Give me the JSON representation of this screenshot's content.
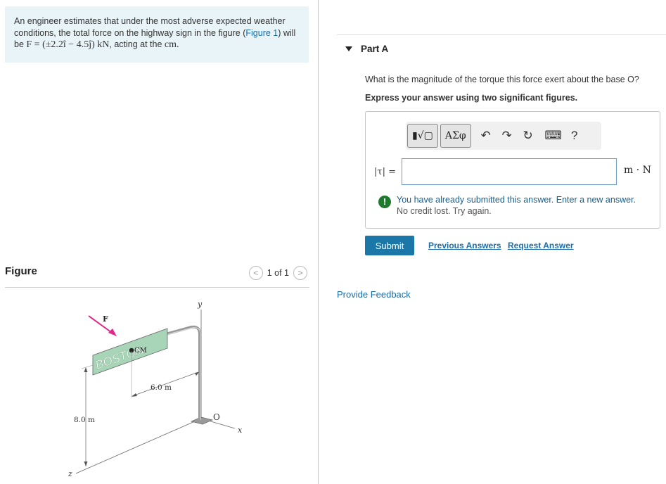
{
  "problem": {
    "text_before_link": "An engineer estimates that under the most adverse expected weather conditions, the total force on the highway sign in the figure (",
    "link": "Figure 1",
    "text_after_link": ") will be",
    "force_vector": "F = (±2.2î − 4.5ĵ) kN",
    "text_end": ", acting at the",
    "cm": "cm."
  },
  "figure": {
    "title": "Figure",
    "pager_text": "1 of 1",
    "prev_icon": "<",
    "next_icon": ">",
    "labels": {
      "force": "F",
      "sign_text": "BOSTON",
      "cm": "CM",
      "width": "6.0 m",
      "height": "8.0 m",
      "origin": "O",
      "x_axis": "x",
      "y_axis": "y",
      "z_axis": "z"
    }
  },
  "part": {
    "label": "Part A",
    "question": "What is the magnitude of the torque this force exert about the base O?",
    "instruction": "Express your answer using two significant figures.",
    "toolbar": {
      "template_btn": "▮√▢",
      "greek_btn": "ΑΣφ",
      "undo_icon": "↶",
      "redo_icon": "↷",
      "reset_icon": "↻",
      "keyboard_icon": "⌨",
      "help_icon": "?"
    },
    "input_label": "|τ| =",
    "input_value": "",
    "unit": "m · N",
    "warning_line1": "You have already submitted this answer. Enter a new answer.",
    "warning_line2": "No credit lost. Try again.",
    "submit": "Submit",
    "previous_answers": "Previous Answers",
    "request_answer": "Request Answer"
  },
  "feedback": "Provide Feedback",
  "colors": {
    "problem_bg": "#e8f4f8",
    "link": "#1a6ea8",
    "submit_bg": "#1a77a8",
    "sign_green": "#a8d5b8",
    "force_arrow": "#e0288a"
  }
}
